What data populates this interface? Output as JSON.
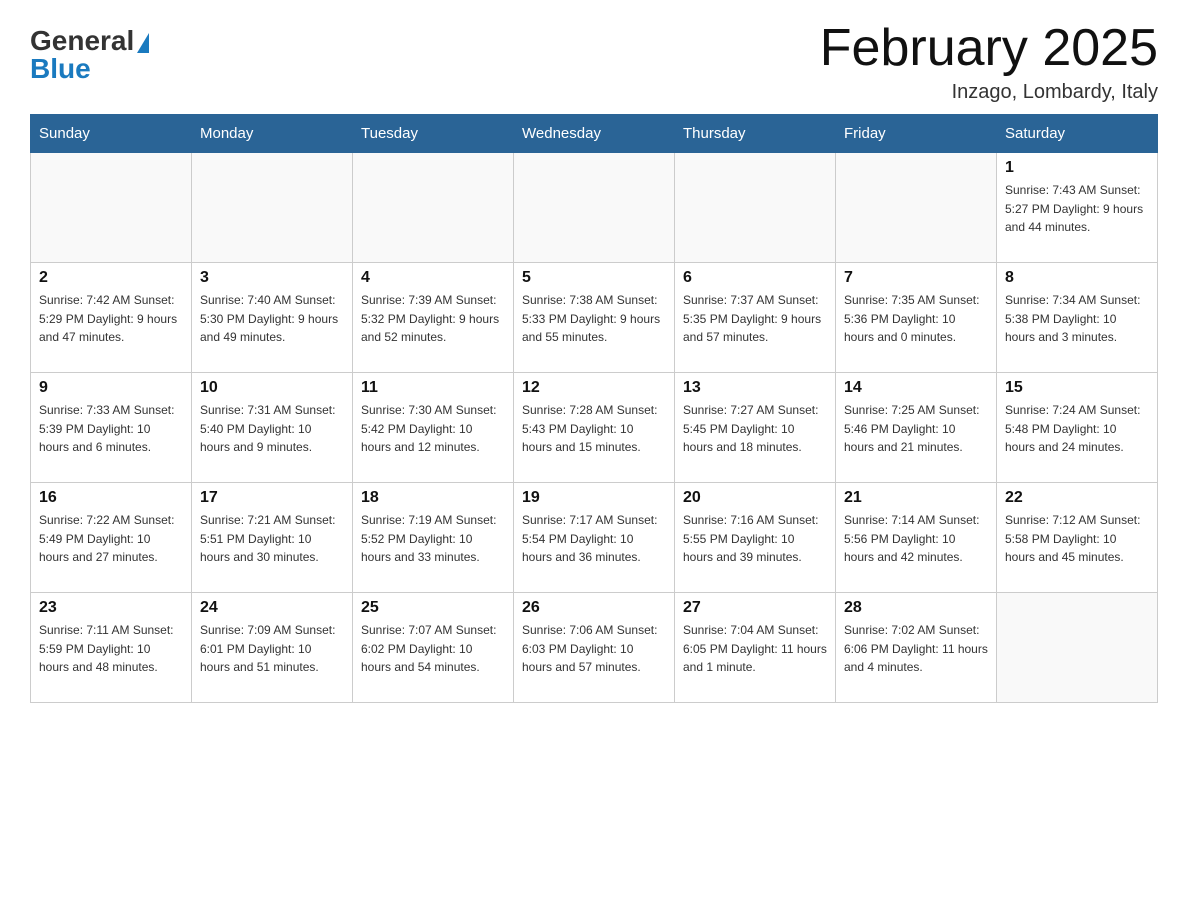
{
  "header": {
    "title": "February 2025",
    "subtitle": "Inzago, Lombardy, Italy",
    "logo_general": "General",
    "logo_blue": "Blue"
  },
  "days_of_week": [
    "Sunday",
    "Monday",
    "Tuesday",
    "Wednesday",
    "Thursday",
    "Friday",
    "Saturday"
  ],
  "weeks": [
    [
      {
        "day": "",
        "info": ""
      },
      {
        "day": "",
        "info": ""
      },
      {
        "day": "",
        "info": ""
      },
      {
        "day": "",
        "info": ""
      },
      {
        "day": "",
        "info": ""
      },
      {
        "day": "",
        "info": ""
      },
      {
        "day": "1",
        "info": "Sunrise: 7:43 AM\nSunset: 5:27 PM\nDaylight: 9 hours and 44 minutes."
      }
    ],
    [
      {
        "day": "2",
        "info": "Sunrise: 7:42 AM\nSunset: 5:29 PM\nDaylight: 9 hours and 47 minutes."
      },
      {
        "day": "3",
        "info": "Sunrise: 7:40 AM\nSunset: 5:30 PM\nDaylight: 9 hours and 49 minutes."
      },
      {
        "day": "4",
        "info": "Sunrise: 7:39 AM\nSunset: 5:32 PM\nDaylight: 9 hours and 52 minutes."
      },
      {
        "day": "5",
        "info": "Sunrise: 7:38 AM\nSunset: 5:33 PM\nDaylight: 9 hours and 55 minutes."
      },
      {
        "day": "6",
        "info": "Sunrise: 7:37 AM\nSunset: 5:35 PM\nDaylight: 9 hours and 57 minutes."
      },
      {
        "day": "7",
        "info": "Sunrise: 7:35 AM\nSunset: 5:36 PM\nDaylight: 10 hours and 0 minutes."
      },
      {
        "day": "8",
        "info": "Sunrise: 7:34 AM\nSunset: 5:38 PM\nDaylight: 10 hours and 3 minutes."
      }
    ],
    [
      {
        "day": "9",
        "info": "Sunrise: 7:33 AM\nSunset: 5:39 PM\nDaylight: 10 hours and 6 minutes."
      },
      {
        "day": "10",
        "info": "Sunrise: 7:31 AM\nSunset: 5:40 PM\nDaylight: 10 hours and 9 minutes."
      },
      {
        "day": "11",
        "info": "Sunrise: 7:30 AM\nSunset: 5:42 PM\nDaylight: 10 hours and 12 minutes."
      },
      {
        "day": "12",
        "info": "Sunrise: 7:28 AM\nSunset: 5:43 PM\nDaylight: 10 hours and 15 minutes."
      },
      {
        "day": "13",
        "info": "Sunrise: 7:27 AM\nSunset: 5:45 PM\nDaylight: 10 hours and 18 minutes."
      },
      {
        "day": "14",
        "info": "Sunrise: 7:25 AM\nSunset: 5:46 PM\nDaylight: 10 hours and 21 minutes."
      },
      {
        "day": "15",
        "info": "Sunrise: 7:24 AM\nSunset: 5:48 PM\nDaylight: 10 hours and 24 minutes."
      }
    ],
    [
      {
        "day": "16",
        "info": "Sunrise: 7:22 AM\nSunset: 5:49 PM\nDaylight: 10 hours and 27 minutes."
      },
      {
        "day": "17",
        "info": "Sunrise: 7:21 AM\nSunset: 5:51 PM\nDaylight: 10 hours and 30 minutes."
      },
      {
        "day": "18",
        "info": "Sunrise: 7:19 AM\nSunset: 5:52 PM\nDaylight: 10 hours and 33 minutes."
      },
      {
        "day": "19",
        "info": "Sunrise: 7:17 AM\nSunset: 5:54 PM\nDaylight: 10 hours and 36 minutes."
      },
      {
        "day": "20",
        "info": "Sunrise: 7:16 AM\nSunset: 5:55 PM\nDaylight: 10 hours and 39 minutes."
      },
      {
        "day": "21",
        "info": "Sunrise: 7:14 AM\nSunset: 5:56 PM\nDaylight: 10 hours and 42 minutes."
      },
      {
        "day": "22",
        "info": "Sunrise: 7:12 AM\nSunset: 5:58 PM\nDaylight: 10 hours and 45 minutes."
      }
    ],
    [
      {
        "day": "23",
        "info": "Sunrise: 7:11 AM\nSunset: 5:59 PM\nDaylight: 10 hours and 48 minutes."
      },
      {
        "day": "24",
        "info": "Sunrise: 7:09 AM\nSunset: 6:01 PM\nDaylight: 10 hours and 51 minutes."
      },
      {
        "day": "25",
        "info": "Sunrise: 7:07 AM\nSunset: 6:02 PM\nDaylight: 10 hours and 54 minutes."
      },
      {
        "day": "26",
        "info": "Sunrise: 7:06 AM\nSunset: 6:03 PM\nDaylight: 10 hours and 57 minutes."
      },
      {
        "day": "27",
        "info": "Sunrise: 7:04 AM\nSunset: 6:05 PM\nDaylight: 11 hours and 1 minute."
      },
      {
        "day": "28",
        "info": "Sunrise: 7:02 AM\nSunset: 6:06 PM\nDaylight: 11 hours and 4 minutes."
      },
      {
        "day": "",
        "info": ""
      }
    ]
  ]
}
